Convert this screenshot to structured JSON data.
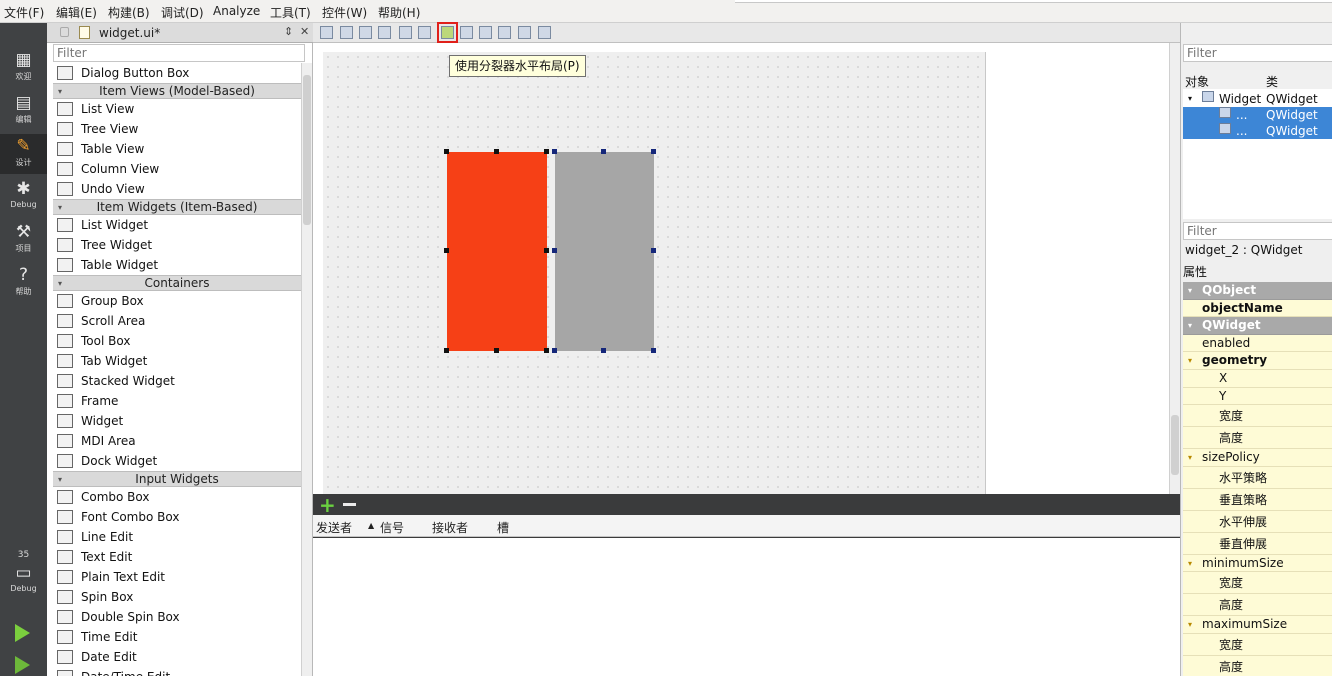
{
  "menu": [
    "文件(F)",
    "编辑(E)",
    "构建(B)",
    "调试(D)",
    "Analyze",
    "工具(T)",
    "控件(W)",
    "帮助(H)"
  ],
  "modes": [
    {
      "label": "欢迎",
      "icon": "grid-icon"
    },
    {
      "label": "编辑",
      "icon": "edit-icon"
    },
    {
      "label": "设计",
      "icon": "pencil-icon"
    },
    {
      "label": "Debug",
      "icon": "bug-icon"
    },
    {
      "label": "项目",
      "icon": "wrench-icon"
    },
    {
      "label": "帮助",
      "icon": "help-icon"
    }
  ],
  "kit": {
    "number": "35",
    "label": "Debug"
  },
  "widgetbox": {
    "file_name": "widget.ui*",
    "filter_placeholder": "Filter",
    "items": [
      {
        "type": "item",
        "label": "Dialog Button Box"
      },
      {
        "type": "cat",
        "label": "Item Views (Model-Based)"
      },
      {
        "type": "item",
        "label": "List View"
      },
      {
        "type": "item",
        "label": "Tree View"
      },
      {
        "type": "item",
        "label": "Table View"
      },
      {
        "type": "item",
        "label": "Column View"
      },
      {
        "type": "item",
        "label": "Undo View"
      },
      {
        "type": "cat",
        "label": "Item Widgets (Item-Based)"
      },
      {
        "type": "item",
        "label": "List Widget"
      },
      {
        "type": "item",
        "label": "Tree Widget"
      },
      {
        "type": "item",
        "label": "Table Widget"
      },
      {
        "type": "cat",
        "label": "Containers"
      },
      {
        "type": "item",
        "label": "Group Box"
      },
      {
        "type": "item",
        "label": "Scroll Area"
      },
      {
        "type": "item",
        "label": "Tool Box"
      },
      {
        "type": "item",
        "label": "Tab Widget"
      },
      {
        "type": "item",
        "label": "Stacked Widget"
      },
      {
        "type": "item",
        "label": "Frame"
      },
      {
        "type": "item",
        "label": "Widget"
      },
      {
        "type": "item",
        "label": "MDI Area"
      },
      {
        "type": "item",
        "label": "Dock Widget"
      },
      {
        "type": "cat",
        "label": "Input Widgets"
      },
      {
        "type": "item",
        "label": "Combo Box"
      },
      {
        "type": "item",
        "label": "Font Combo Box"
      },
      {
        "type": "item",
        "label": "Line Edit"
      },
      {
        "type": "item",
        "label": "Text Edit"
      },
      {
        "type": "item",
        "label": "Plain Text Edit"
      },
      {
        "type": "item",
        "label": "Spin Box"
      },
      {
        "type": "item",
        "label": "Double Spin Box"
      },
      {
        "type": "item",
        "label": "Time Edit"
      },
      {
        "type": "item",
        "label": "Date Edit"
      },
      {
        "type": "item",
        "label": "Date/Time Edit"
      }
    ]
  },
  "editor": {
    "tooltip": "使用分裂器水平布局(P)",
    "widget_colors": [
      "#f64016",
      "#a6a6a6"
    ]
  },
  "signals": {
    "columns": [
      "发送者",
      "信号",
      "接收者",
      "槽"
    ]
  },
  "object_inspector": {
    "filter_placeholder": "Filter",
    "col_object": "对象",
    "col_class": "类",
    "rows": [
      {
        "name": "Widget",
        "cls": "QWidget",
        "selected": false
      },
      {
        "name": "...",
        "cls": "QWidget",
        "selected": true
      },
      {
        "name": "...",
        "cls": "QWidget",
        "selected": true
      }
    ]
  },
  "property_editor": {
    "filter_placeholder": "Filter",
    "object_name": "widget_2 : QWidget",
    "label": "属性",
    "rows": [
      {
        "name": "QObject",
        "kind": "group"
      },
      {
        "name": "objectName",
        "kind": "bold"
      },
      {
        "name": "QWidget",
        "kind": "group"
      },
      {
        "name": "enabled",
        "kind": "prop"
      },
      {
        "name": "geometry",
        "kind": "expand-bold"
      },
      {
        "name": "X",
        "kind": "sub"
      },
      {
        "name": "Y",
        "kind": "sub"
      },
      {
        "name": "宽度",
        "kind": "sub-tall"
      },
      {
        "name": "高度",
        "kind": "sub-tall"
      },
      {
        "name": "sizePolicy",
        "kind": "expand"
      },
      {
        "name": "水平策略",
        "kind": "sub-tall"
      },
      {
        "name": "垂直策略",
        "kind": "sub-tall"
      },
      {
        "name": "水平伸展",
        "kind": "sub-tall"
      },
      {
        "name": "垂直伸展",
        "kind": "sub-tall"
      },
      {
        "name": "minimumSize",
        "kind": "expand"
      },
      {
        "name": "宽度",
        "kind": "sub-tall"
      },
      {
        "name": "高度",
        "kind": "sub-tall"
      },
      {
        "name": "maximumSize",
        "kind": "expand"
      },
      {
        "name": "宽度",
        "kind": "sub-tall"
      },
      {
        "name": "高度",
        "kind": "sub-tall"
      }
    ]
  }
}
